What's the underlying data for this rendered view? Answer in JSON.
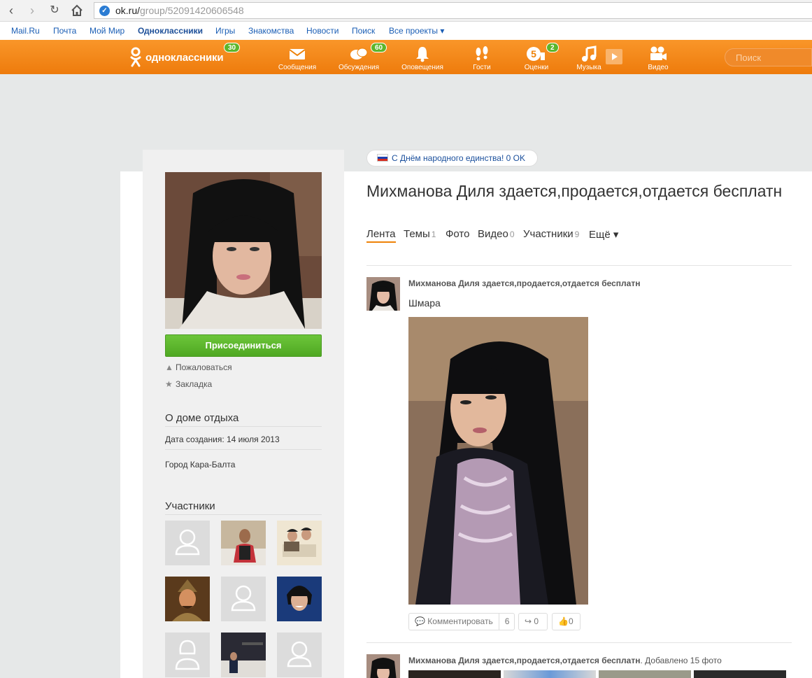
{
  "browser": {
    "url_host": "ok.ru/",
    "url_path": "group/52091420606548",
    "secure_icon": "check-icon"
  },
  "portal_nav": [
    {
      "label": "Mail.Ru"
    },
    {
      "label": "Почта"
    },
    {
      "label": "Мой Мир"
    },
    {
      "label": "Одноклассники",
      "active": true
    },
    {
      "label": "Игры"
    },
    {
      "label": "Знакомства"
    },
    {
      "label": "Новости"
    },
    {
      "label": "Поиск"
    },
    {
      "label": "Все проекты ▾"
    }
  ],
  "header": {
    "logo_text": "одноклассники",
    "logo_badge": "30",
    "nav": [
      {
        "label": "Сообщения",
        "icon": "envelope-icon"
      },
      {
        "label": "Обсуждения",
        "icon": "chat-icon",
        "badge": "60"
      },
      {
        "label": "Оповещения",
        "icon": "bell-icon"
      },
      {
        "label": "Гости",
        "icon": "footprints-icon"
      },
      {
        "label": "Оценки",
        "icon": "rating-icon",
        "badge": "2"
      },
      {
        "label": "Музыка",
        "icon": "music-icon"
      },
      {
        "label": "Видео",
        "icon": "video-camera-icon"
      }
    ],
    "search_placeholder": "Поиск",
    "colors": {
      "orange": "#ee8208",
      "badge_green": "#5cb52b"
    }
  },
  "sidebar": {
    "join_label": "Присоединиться",
    "complain_label": "Пожаловаться",
    "bookmark_label": "Закладка",
    "about_heading": "О доме отдыха",
    "created_label": "Дата создания: 14 июля 2013",
    "city_label": "Город Кара-Балта",
    "members_heading": "Участники"
  },
  "main": {
    "holiday_text": "С Днём народного единства! 0 OK",
    "title": "Михманова Диля здается,продается,отдается бесплатн",
    "tabs": [
      {
        "label": "Лента",
        "count": "",
        "active": true
      },
      {
        "label": "Темы",
        "count": "1"
      },
      {
        "label": "Фото",
        "count": ""
      },
      {
        "label": "Видео",
        "count": "0"
      },
      {
        "label": "Участники",
        "count": "9"
      },
      {
        "label": "Ещё ▾",
        "count": ""
      }
    ],
    "posts": [
      {
        "author": "Михманова Диля здается,продается,отдается бесплатн",
        "text": "Шмара",
        "comment_label": "Комментировать",
        "comment_count": "6",
        "share_count": "0",
        "like_count": "0"
      },
      {
        "author": "Михманова Диля здается,продается,отдается бесплатн",
        "extra": ". Добавлено 15 фото"
      }
    ]
  }
}
